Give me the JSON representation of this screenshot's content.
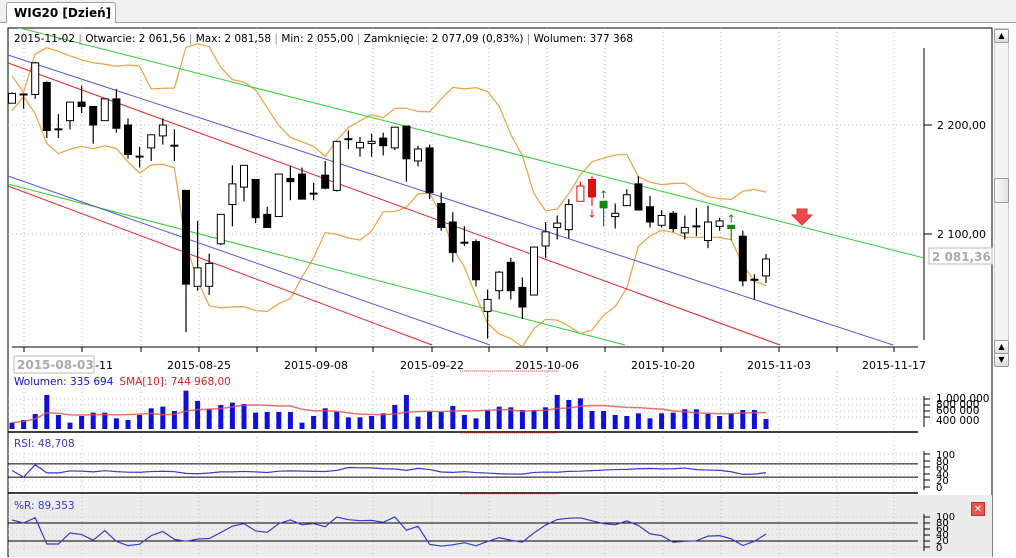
{
  "tab": {
    "title": "WIG20 [Dzień]"
  },
  "info_bar": {
    "date": "2015-11-02",
    "open": "Otwarcie: 2 061,56",
    "max": "Max: 2 081,58",
    "min": "Min: 2 055,00",
    "close": "Zamknięcie: 2 077,09 (0,83%)",
    "volume": "Wolumen: 377 368"
  },
  "colors": {
    "up": "#ffffff",
    "down": "#000000",
    "sell": "#e01010",
    "buy": "#118811",
    "bollinger": "#f0a040",
    "volume": "#1010dd",
    "sma": "#e05050",
    "indicator": "#3a3acc",
    "channel_green": "#33cc33",
    "channel_blue": "#5555dd",
    "channel_red": "#dd2222"
  },
  "chart_data": {
    "type": "candlestick",
    "title": "WIG20 [Dzień]",
    "price_axis": {
      "ticks": [
        "2 200,00",
        "2 100,00"
      ],
      "tick_values": [
        2200,
        2100
      ],
      "current_label": "2 081,36",
      "current_value": 2081.36
    },
    "x_axis": {
      "first_date_box": "2015-08-03",
      "labels": [
        "-11",
        "2015-08-25",
        "2015-09-08",
        "2015-09-22",
        "2015-10-06",
        "2015-10-20",
        "2015-11-03",
        "2015-11-17"
      ]
    },
    "candles": [
      [
        2220,
        2230,
        2220,
        2229
      ],
      [
        2228,
        2229,
        2215,
        2227
      ],
      [
        2228,
        2258,
        2224,
        2257
      ],
      [
        2239,
        2240,
        2188,
        2195
      ],
      [
        2196,
        2210,
        2188,
        2195
      ],
      [
        2204,
        2221,
        2196,
        2221
      ],
      [
        2221,
        2236,
        2211,
        2217
      ],
      [
        2217,
        2217,
        2183,
        2200
      ],
      [
        2204,
        2224,
        2204,
        2224
      ],
      [
        2224,
        2233,
        2193,
        2197
      ],
      [
        2200,
        2206,
        2169,
        2173
      ],
      [
        2171,
        2180,
        2161,
        2170
      ],
      [
        2179,
        2191,
        2167,
        2191
      ],
      [
        2190,
        2206,
        2182,
        2200
      ],
      [
        2181,
        2196,
        2167,
        2180
      ],
      [
        2140,
        2140,
        2010,
        2054
      ],
      [
        2052,
        2112,
        2048,
        2069
      ],
      [
        2052,
        2082,
        2044,
        2073
      ],
      [
        2091,
        2118,
        2090,
        2118
      ],
      [
        2127,
        2163,
        2107,
        2146
      ],
      [
        2143,
        2163,
        2130,
        2163
      ],
      [
        2150,
        2150,
        2110,
        2115
      ],
      [
        2118,
        2125,
        2106,
        2106
      ],
      [
        2116,
        2155,
        2116,
        2155
      ],
      [
        2151,
        2163,
        2131,
        2148
      ],
      [
        2155,
        2161,
        2132,
        2132
      ],
      [
        2137,
        2147,
        2131,
        2137
      ],
      [
        2154,
        2167,
        2141,
        2142
      ],
      [
        2140,
        2185,
        2139,
        2185
      ],
      [
        2187,
        2195,
        2178,
        2187
      ],
      [
        2179,
        2189,
        2171,
        2184
      ],
      [
        2183,
        2192,
        2171,
        2185
      ],
      [
        2188,
        2193,
        2172,
        2181
      ],
      [
        2179,
        2198,
        2177,
        2198
      ],
      [
        2199,
        2199,
        2148,
        2169
      ],
      [
        2167,
        2181,
        2162,
        2178
      ],
      [
        2179,
        2182,
        2132,
        2138
      ],
      [
        2128,
        2138,
        2103,
        2106
      ],
      [
        2111,
        2120,
        2074,
        2083
      ],
      [
        2092,
        2107,
        2089,
        2092
      ],
      [
        2093,
        2095,
        2052,
        2058
      ],
      [
        2029,
        2049,
        2004,
        2040
      ],
      [
        2048,
        2066,
        2040,
        2065
      ],
      [
        2074,
        2078,
        2040,
        2048
      ],
      [
        2051,
        2060,
        2022,
        2033
      ],
      [
        2044,
        2088,
        2044,
        2088
      ],
      [
        2089,
        2111,
        2078,
        2102
      ],
      [
        2106,
        2117,
        2095,
        2110
      ],
      [
        2104,
        2132,
        2096,
        2127
      ],
      [
        2130,
        2148,
        2130,
        2144
      ],
      [
        2150,
        2153,
        2126,
        2134
      ],
      [
        2130,
        2130,
        2107,
        2124
      ],
      [
        2116,
        2128,
        2105,
        2119
      ],
      [
        2126,
        2141,
        2126,
        2136
      ],
      [
        2146,
        2153,
        2122,
        2122
      ],
      [
        2125,
        2135,
        2106,
        2111
      ],
      [
        2108,
        2122,
        2106,
        2117
      ],
      [
        2119,
        2121,
        2102,
        2105
      ],
      [
        2101,
        2117,
        2095,
        2106
      ],
      [
        2107,
        2124,
        2098,
        2107
      ],
      [
        2094,
        2126,
        2087,
        2111
      ],
      [
        2107,
        2115,
        2103,
        2112
      ],
      [
        2108,
        2108,
        2094,
        2105
      ],
      [
        2098,
        2103,
        2052,
        2057
      ],
      [
        2058,
        2063,
        2040,
        2058
      ],
      [
        2061.56,
        2081.58,
        2055.0,
        2077.09
      ]
    ],
    "candle_fields": [
      "open",
      "high",
      "low",
      "close"
    ],
    "signals": {
      "sell": [
        49,
        50
      ],
      "buy": [
        51,
        62
      ],
      "sell_arrows": [
        50
      ],
      "buy_arrows": [
        51,
        62
      ],
      "forecast_sell_arrow": true
    },
    "volume": {
      "label": "Wolumen: 335 694",
      "sma_label": "SMA[10]: 744 968,00",
      "ticks": [
        "1 000 000",
        "800 000",
        "600 000",
        "400 000"
      ],
      "tick_values": [
        1000000,
        800000,
        600000,
        400000
      ],
      "values": [
        213000,
        303000,
        506000,
        1146000,
        472000,
        213000,
        438000,
        551000,
        551000,
        360000,
        303000,
        472000,
        697000,
        753000,
        607000,
        1292000,
        944000,
        685000,
        809000,
        888000,
        843000,
        551000,
        573000,
        573000,
        573000,
        213000,
        438000,
        697000,
        584000,
        393000,
        393000,
        438000,
        528000,
        809000,
        1146000,
        416000,
        584000,
        573000,
        775000,
        472000,
        360000,
        640000,
        753000,
        730000,
        640000,
        640000,
        730000,
        1146000,
        977000,
        1034000,
        607000,
        607000,
        472000,
        438000,
        528000,
        360000,
        528000,
        551000,
        663000,
        663000,
        506000,
        438000,
        528000,
        640000,
        640000,
        335694
      ]
    },
    "rsi": {
      "label": "RSI: 48,708",
      "ticks": [
        "100",
        "80",
        "60",
        "40",
        "20",
        "0"
      ],
      "levels": [
        70,
        30
      ]
    },
    "williams_r": {
      "label": "%R: 89,353",
      "ticks": [
        "100",
        "80",
        "60",
        "40",
        "20",
        "0"
      ],
      "levels": [
        80,
        20
      ]
    }
  }
}
